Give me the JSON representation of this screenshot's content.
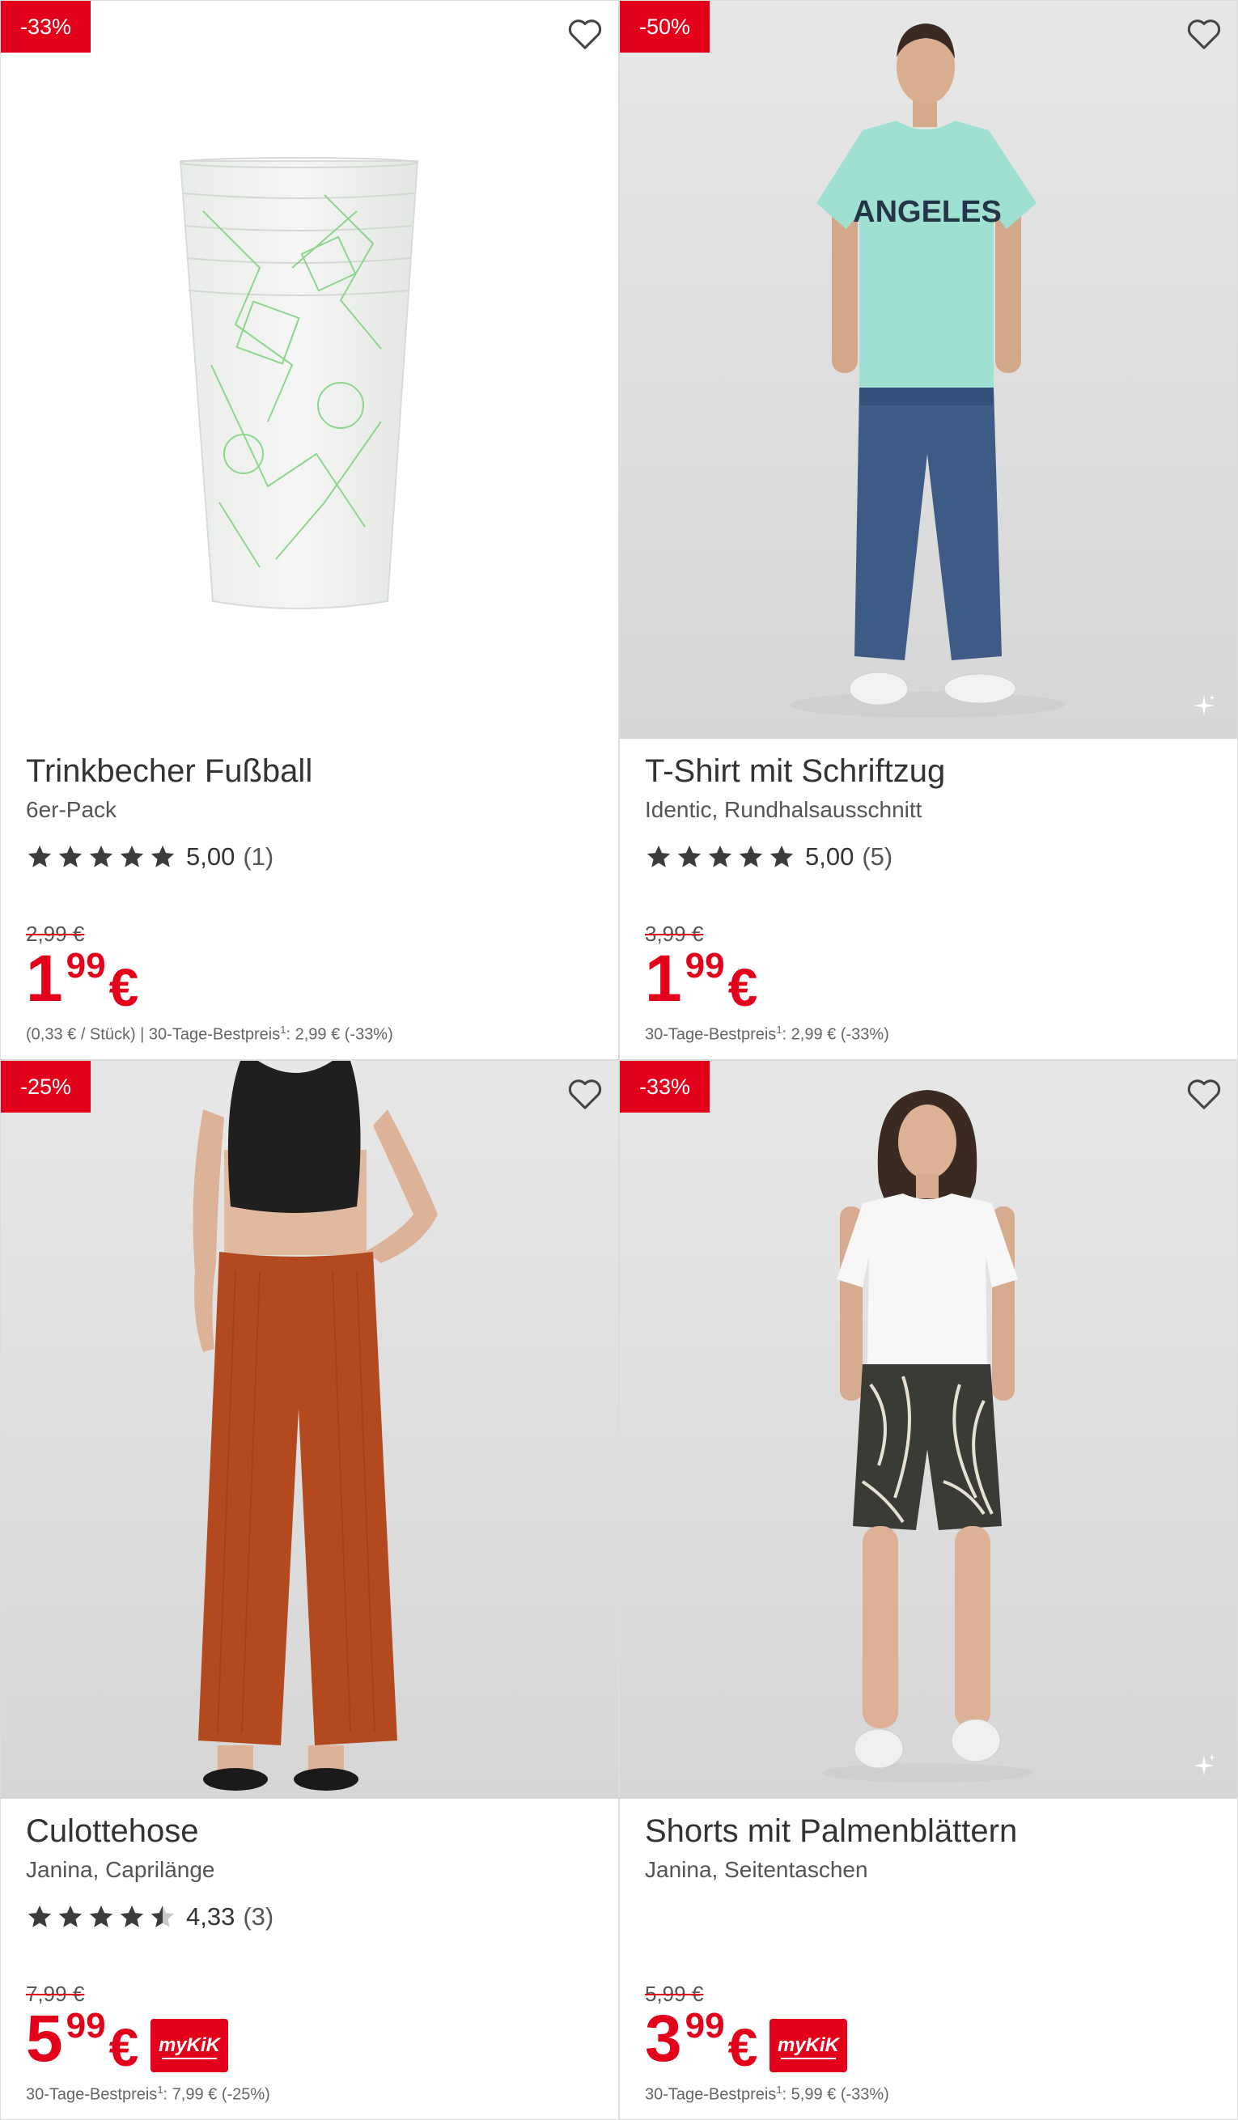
{
  "colors": {
    "accent": "#e2001a",
    "star": "#3c3c3c",
    "star_empty": "#c8c8c8"
  },
  "products": [
    {
      "badge": "-33%",
      "title": "Trinkbecher Fußball",
      "subtitle": "6er-Pack",
      "rating": {
        "stars": 5.0,
        "value": "5,00",
        "count": "(1)"
      },
      "old_price": "2,99 €",
      "price": {
        "euros": "1",
        "cents": "99",
        "currency": "€"
      },
      "mykik": false,
      "footnote": {
        "pre": "(0,33 € / Stück)   |  30-Tage-Bestpreis",
        "sup": "1",
        "post": ": 2,99 € (-33%)"
      },
      "image": "cups-image"
    },
    {
      "badge": "-50%",
      "title": "T-Shirt mit Schriftzug",
      "subtitle": "Identic, Rundhalsausschnitt",
      "rating": {
        "stars": 5.0,
        "value": "5,00",
        "count": "(5)"
      },
      "old_price": "3,99 €",
      "price": {
        "euros": "1",
        "cents": "99",
        "currency": "€"
      },
      "mykik": false,
      "footnote": {
        "pre": "30-Tage-Bestpreis",
        "sup": "1",
        "post": ": 2,99 € (-33%)"
      },
      "image": "tshirt-model-image",
      "shirt_text": "ANGELES"
    },
    {
      "badge": "-25%",
      "title": "Culottehose",
      "subtitle": "Janina, Caprilänge",
      "rating": {
        "stars": 4.33,
        "value": "4,33",
        "count": "(3)"
      },
      "old_price": "7,99 €",
      "price": {
        "euros": "5",
        "cents": "99",
        "currency": "€"
      },
      "mykik": true,
      "mykik_label": "myKiK",
      "footnote": {
        "pre": "30-Tage-Bestpreis",
        "sup": "1",
        "post": ": 7,99 € (-25%)"
      },
      "image": "culotte-model-image"
    },
    {
      "badge": "-33%",
      "title": "Shorts mit Palmenblättern",
      "subtitle": "Janina, Seitentaschen",
      "rating": null,
      "old_price": "5,99 €",
      "price": {
        "euros": "3",
        "cents": "99",
        "currency": "€"
      },
      "mykik": true,
      "mykik_label": "myKiK",
      "footnote": {
        "pre": "30-Tage-Bestpreis",
        "sup": "1",
        "post": ": 5,99 € (-33%)"
      },
      "image": "shorts-model-image"
    }
  ]
}
